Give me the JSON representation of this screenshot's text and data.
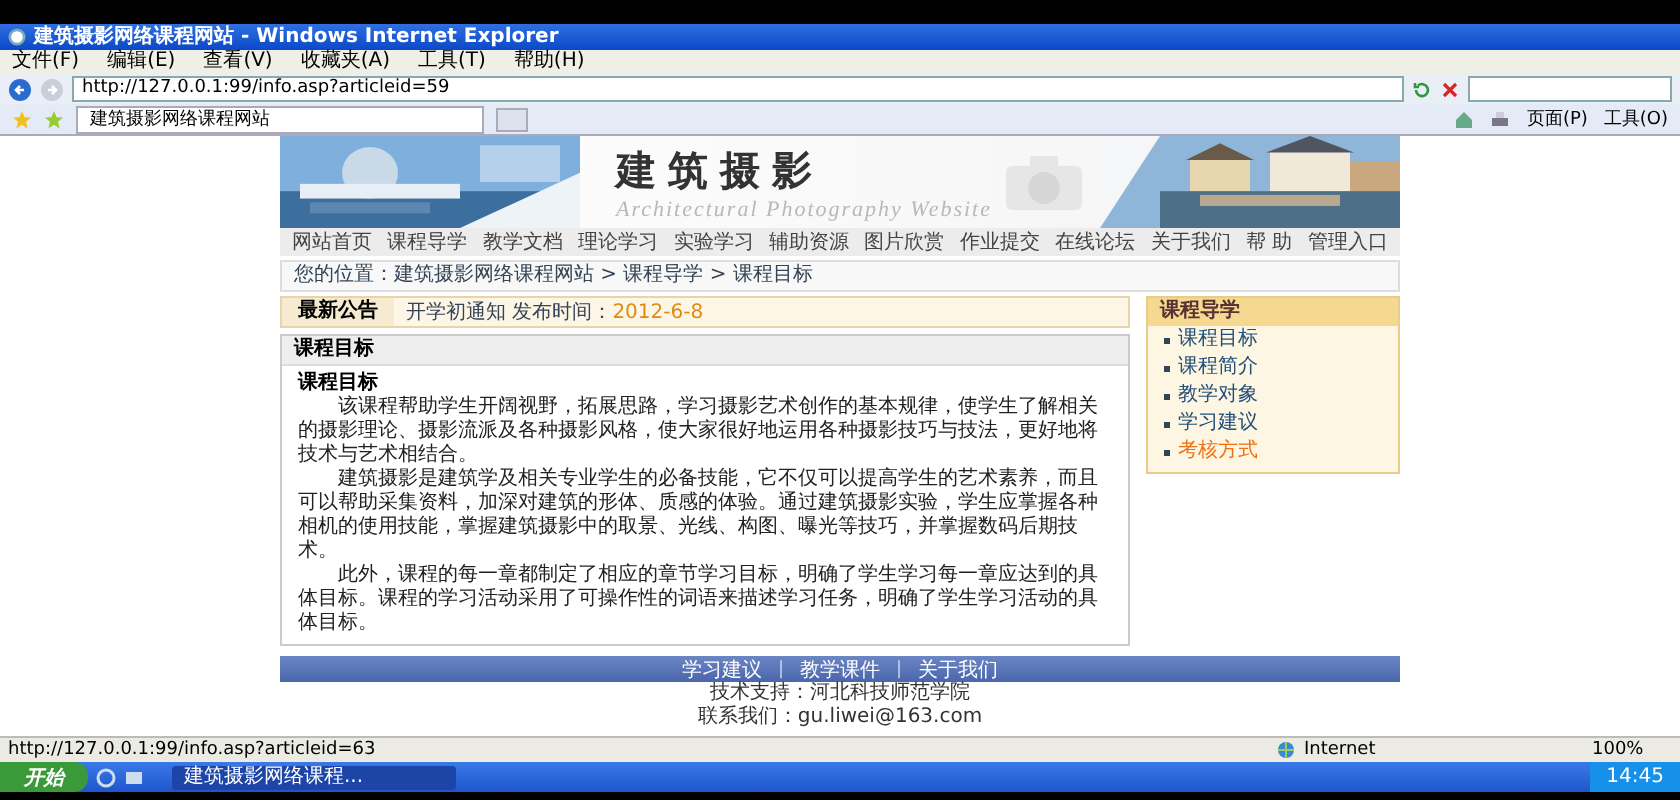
{
  "window": {
    "title": "建筑摄影网络课程网站 - Windows Internet Explorer"
  },
  "menu": [
    "文件(F)",
    "编辑(E)",
    "查看(V)",
    "收藏夹(A)",
    "工具(T)",
    "帮助(H)"
  ],
  "address": {
    "value": "http://127.0.0.1:99/info.asp?articleid=59"
  },
  "tab": {
    "label": "建筑摄影网络课程网站"
  },
  "command_bar": [
    "页面(P)",
    "工具(O)"
  ],
  "site": {
    "title": "建筑摄影",
    "subtitle": "Architectural Photography Website",
    "nav": [
      "网站首页",
      "课程导学",
      "教学文档",
      "理论学习",
      "实验学习",
      "辅助资源",
      "图片欣赏",
      "作业提交",
      "在线论坛",
      "关于我们",
      "帮 助",
      "管理入口"
    ],
    "breadcrumb": "您的位置：建筑摄影网络课程网站 > 课程导学 > 课程目标",
    "notice": {
      "label": "最新公告",
      "text": "开学初通知 发布时间：",
      "date": "2012-6-8"
    },
    "content": {
      "header": "课程目标",
      "heading": "课程目标",
      "paragraphs": [
        "该课程帮助学生开阔视野，拓展思路，学习摄影艺术创作的基本规律，使学生了解相关的摄影理论、摄影流派及各种摄影风格，使大家很好地运用各种摄影技巧与技法，更好地将技术与艺术相结合。",
        "建筑摄影是建筑学及相关专业学生的必备技能，它不仅可以提高学生的艺术素养，而且可以帮助采集资料，加深对建筑的形体、质感的体验。通过建筑摄影实验，学生应掌握各种相机的使用技能，掌握建筑摄影中的取景、光线、构图、曝光等技巧，并掌握数码后期技术。",
        "此外，课程的每一章都制定了相应的章节学习目标，明确了学生学习每一章应达到的具体目标。课程的学习活动采用了可操作性的词语来描述学习任务，明确了学生学习活动的具体目标。"
      ]
    },
    "sidebar": {
      "header": "课程导学",
      "items": [
        {
          "label": "课程目标",
          "hovered": false
        },
        {
          "label": "课程简介",
          "hovered": false
        },
        {
          "label": "教学对象",
          "hovered": false
        },
        {
          "label": "学习建议",
          "hovered": false
        },
        {
          "label": "考核方式",
          "hovered": true
        }
      ]
    },
    "footer": {
      "links": [
        {
          "kind": "link",
          "text": "学习建议"
        },
        {
          "kind": "separator",
          "text": "|"
        },
        {
          "kind": "link",
          "text": "教学课件"
        },
        {
          "kind": "separator",
          "text": "|"
        },
        {
          "kind": "link",
          "text": "关于我们"
        }
      ],
      "lines": [
        "技术支持：河北科技师范学院",
        "联系我们：gu.liwei@163.com"
      ]
    }
  },
  "status_bar": {
    "url": "http://127.0.0.1:99/info.asp?articleid=63",
    "zone": "Internet",
    "zoom": "100%"
  },
  "taskbar": {
    "start": "开始",
    "tasks": [
      {
        "label": "建筑摄影网络课程...",
        "selected": true
      }
    ],
    "clock": "14:45"
  }
}
